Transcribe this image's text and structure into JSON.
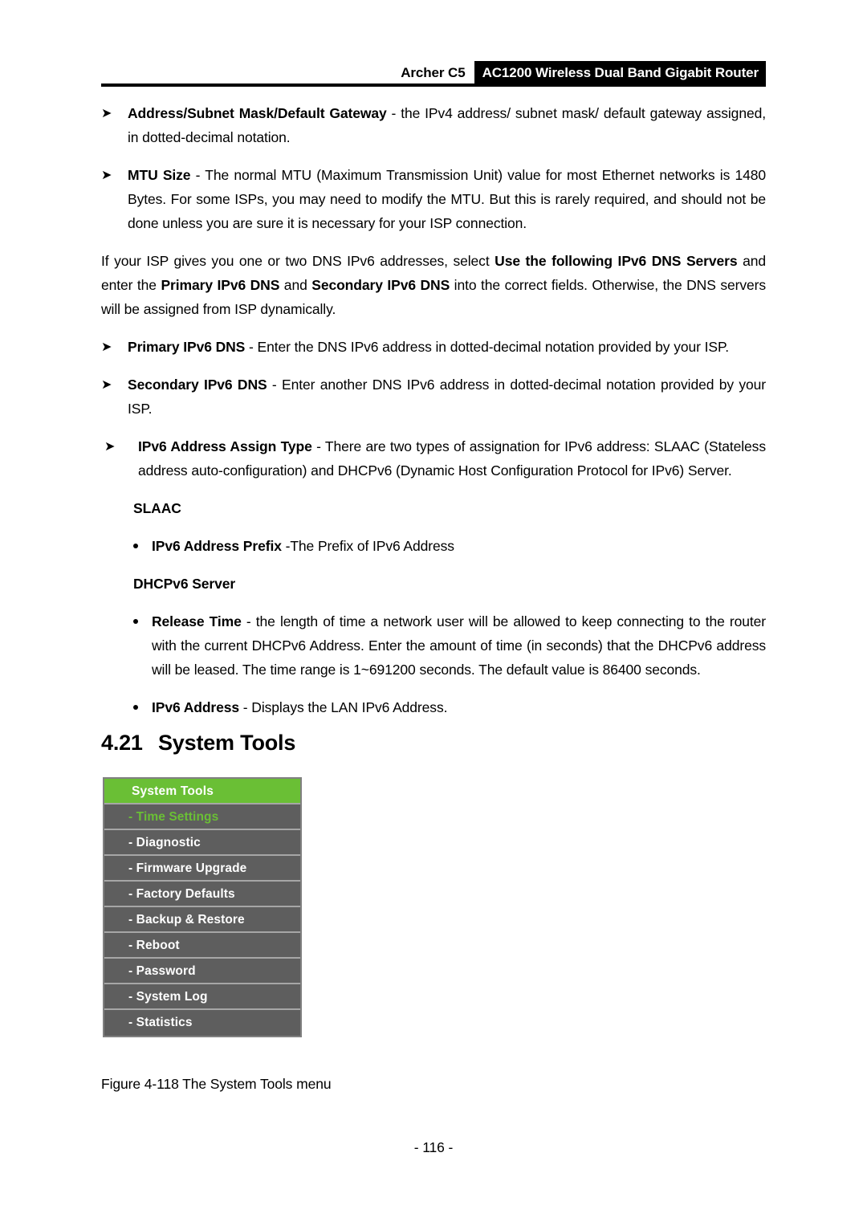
{
  "header": {
    "model": "Archer C5",
    "product": "AC1200 Wireless Dual Band Gigabit Router"
  },
  "body": {
    "item_address": {
      "marker": "➤",
      "term": "Address/Subnet Mask/Default Gateway",
      "text": " - the IPv4 address/ subnet mask/ default gateway assigned, in dotted-decimal notation."
    },
    "item_mtu": {
      "marker": "➤",
      "term": "MTU Size",
      "text": " - The normal MTU (Maximum Transmission Unit) value for most Ethernet networks is 1480 Bytes. For some ISPs, you may need to modify the MTU. But this is rarely required, and should not be done unless you are sure it is necessary for your ISP connection."
    },
    "paragraph_dns": {
      "part1": "If your ISP gives you one or two DNS IPv6 addresses, select ",
      "bold1": "Use the following IPv6 DNS Servers",
      "part2": " and enter the ",
      "bold2": "Primary IPv6 DNS",
      "part3": " and ",
      "bold3": "Secondary IPv6 DNS",
      "part4": " into the correct fields. Otherwise, the DNS servers will be assigned from ISP dynamically."
    },
    "item_primary_dns": {
      "marker": "➤",
      "term": "Primary IPv6 DNS",
      "text": " - Enter the DNS IPv6 address in dotted-decimal notation provided by your ISP."
    },
    "item_secondary_dns": {
      "marker": "➤",
      "term": "Secondary IPv6 DNS",
      "text": " - Enter another DNS IPv6 address in dotted-decimal notation provided by your ISP."
    },
    "item_assign_type": {
      "marker": "➤",
      "term": "IPv6 Address Assign Type",
      "text": " - There are two types of assignation for IPv6 address: SLAAC (Stateless address auto-configuration) and DHCPv6 (Dynamic Host Configuration Protocol for IPv6) Server."
    },
    "subhead_slaac": "SLAAC",
    "item_prefix": {
      "term": "IPv6 Address Prefix",
      "text": " -The Prefix of IPv6 Address"
    },
    "subhead_dhcpv6": "DHCPv6 Server",
    "item_release_time": {
      "term": "Release Time",
      "text": " - the length of time a network user will be allowed to keep connecting to the router with the current DHCPv6 Address. Enter the amount of time (in seconds) that the DHCPv6 address will be leased. The time range is 1~691200 seconds. The default value is 86400 seconds."
    },
    "item_ipv6_address": {
      "term": "IPv6 Address",
      "text": " - Displays the LAN IPv6 Address."
    }
  },
  "section": {
    "number": "4.21",
    "title": "System Tools"
  },
  "menu": {
    "header_label": "System Tools",
    "items": [
      {
        "label": "- Time Settings",
        "active": true
      },
      {
        "label": "- Diagnostic",
        "active": false
      },
      {
        "label": "- Firmware Upgrade",
        "active": false
      },
      {
        "label": "- Factory Defaults",
        "active": false
      },
      {
        "label": "- Backup & Restore",
        "active": false
      },
      {
        "label": "- Reboot",
        "active": false
      },
      {
        "label": "- Password",
        "active": false
      },
      {
        "label": "- System Log",
        "active": false
      },
      {
        "label": "- Statistics",
        "active": false
      }
    ],
    "colors": {
      "header_green": "#6abf35",
      "item_gray": "#5e5e5e",
      "separator": "#a6a6a6",
      "active_text": "#6abf35"
    }
  },
  "figure": {
    "caption": "Figure 4-118 The System Tools menu"
  },
  "footer": {
    "page_number": "- 116 -"
  }
}
